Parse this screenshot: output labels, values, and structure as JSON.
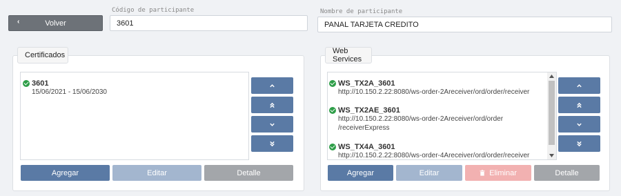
{
  "header": {
    "back_label": "Volver",
    "participant_code": {
      "label": "Código de participante",
      "value": "3601"
    },
    "participant_name": {
      "label": "Nombre de participante",
      "value": "PANAL TARJETA CREDITO"
    }
  },
  "certificates": {
    "title": "Certificados",
    "items": [
      {
        "name": "3601",
        "dates": "15/06/2021 - 15/06/2030"
      }
    ],
    "buttons": {
      "add": "Agregar",
      "edit": "Editar",
      "detail": "Detalle"
    }
  },
  "web_services": {
    "title": "Web Services",
    "items": [
      {
        "name": "WS_TX2A_3601",
        "url_lines": [
          "http://10.150.2.22:8080/ws-order-2Areceiver/ord/order/receiver"
        ]
      },
      {
        "name": "WS_TX2AE_3601",
        "url_lines": [
          "http://10.150.2.22:8080/ws-order-2Areceiver/ord/order",
          "/receiverExpress"
        ]
      },
      {
        "name": "WS_TX4A_3601",
        "url_lines": [
          "http://10.150.2.22:8080/ws-order-4Areceiver/ord/order/receiver"
        ]
      }
    ],
    "buttons": {
      "add": "Agregar",
      "edit": "Editar",
      "delete": "Eliminar",
      "detail": "Detalle"
    }
  },
  "colors": {
    "primary": "#5a7aa5",
    "primary_disabled": "#a3b6cf",
    "neutral": "#a3a6aa",
    "danger_disabled": "#f2b1b1",
    "status_ok": "#2e9e48"
  },
  "icons": {
    "back": "chevron-left-icon",
    "status": "check-circle-icon",
    "move": [
      "chevron-up-icon",
      "double-chevron-up-icon",
      "chevron-down-icon",
      "double-chevron-down-icon"
    ],
    "delete": "trash-icon"
  }
}
